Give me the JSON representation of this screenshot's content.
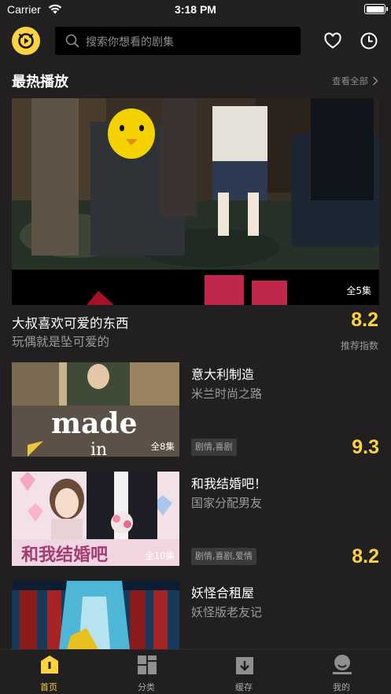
{
  "status_bar": {
    "carrier": "Carrier",
    "time": "3:18 PM"
  },
  "header": {
    "search_placeholder": "搜索你想看的剧集"
  },
  "section": {
    "title": "最热播放",
    "view_all": "查看全部"
  },
  "featured": {
    "title": "大叔喜欢可爱的东西",
    "subtitle": "玩偶就是坠可爱的",
    "episodes": "全5集",
    "score": "8.2",
    "score_label": "推荐指数"
  },
  "list": [
    {
      "title": "意大利制造",
      "subtitle": "米兰时尚之路",
      "episodes": "全8集",
      "tags": "剧情,喜剧",
      "score": "9.3"
    },
    {
      "title": "和我结婚吧！",
      "subtitle": "国家分配男友",
      "episodes": "全10集",
      "tags": "剧情,喜剧,爱情",
      "score": "8.2"
    },
    {
      "title": "妖怪合租屋",
      "subtitle": "妖怪版老友记",
      "episodes": "",
      "tags": "",
      "score": ""
    }
  ],
  "tabs": [
    {
      "label": "首页",
      "icon": "home-icon",
      "active": true
    },
    {
      "label": "分类",
      "icon": "category-icon",
      "active": false
    },
    {
      "label": "缓存",
      "icon": "download-icon",
      "active": false
    },
    {
      "label": "我的",
      "icon": "profile-icon",
      "active": false
    }
  ],
  "colors": {
    "background": "#211f20",
    "accent": "#fbd23f",
    "muted": "#9a9a9a"
  }
}
